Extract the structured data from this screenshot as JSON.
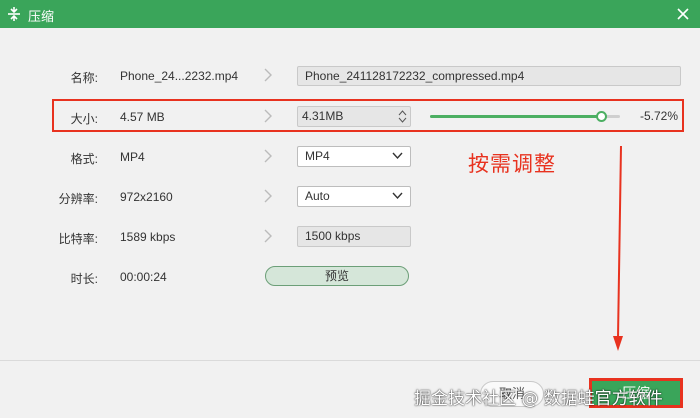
{
  "window": {
    "title": "压缩",
    "accent_color": "#3aa55a",
    "title_icon": "compress-icon",
    "close_icon": "close-icon"
  },
  "rows": {
    "name": {
      "label": "名称:",
      "original": "Phone_24...2232.mp4",
      "output": "Phone_241128172232_compressed.mp4"
    },
    "size": {
      "label": "大小:",
      "original": "4.57 MB",
      "output": "4.31MB",
      "slider_fraction": 0.9,
      "percent": "-5.72%"
    },
    "format": {
      "label": "格式:",
      "original": "MP4",
      "output": "MP4"
    },
    "resolution": {
      "label": "分辨率:",
      "original": "972x2160",
      "output": "Auto"
    },
    "bitrate": {
      "label": "比特率:",
      "original": "1589 kbps",
      "output": "1500 kbps"
    },
    "duration": {
      "label": "时长:",
      "original": "00:00:24",
      "preview_label": "预览"
    }
  },
  "annotation": {
    "text": "按需调整",
    "color": "#e8321f"
  },
  "footer": {
    "cancel_label": "取消",
    "compress_label": "压缩",
    "watermark": "掘金技术社区 @ 数据蛙官方软件"
  }
}
